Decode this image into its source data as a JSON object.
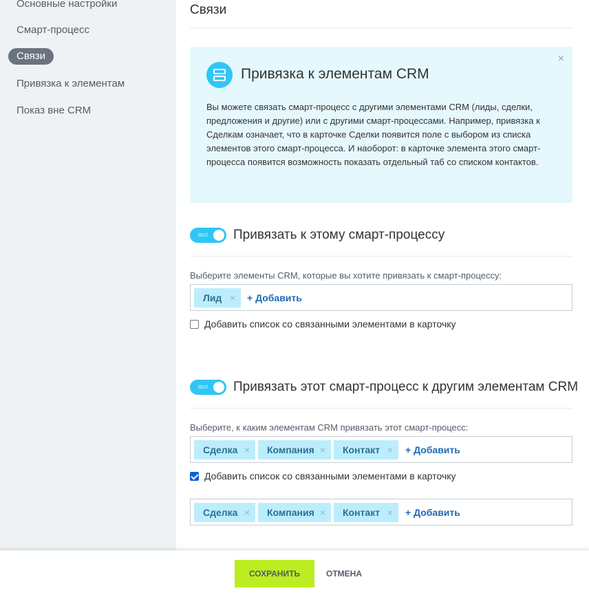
{
  "sidebar": {
    "items": [
      {
        "label": "Основные настройки"
      },
      {
        "label": "Смарт-процесс"
      },
      {
        "label": "Связи",
        "active": true
      },
      {
        "label": "Привязка к элементам"
      },
      {
        "label": "Показ вне CRM"
      }
    ]
  },
  "main": {
    "title": "Связи",
    "info": {
      "title": "Привязка к элементам CRM",
      "text": "Вы можете связать смарт-процесс с другими элементами CRM (лиды, сделки, предложения и другие) или с другими смарт-процессами. Например, привязка к Сделкам означает, что в карточке Сделки появится поле с выбором из списка элементов этого смарт-процесса. И наоборот: в карточке элемента этого смарт-процесса появится возможность показать отдельный таб со списком контактов.",
      "close": "×",
      "icon": "list-icon"
    },
    "section1": {
      "toggle_label": "вкл",
      "toggle_on": true,
      "title": "Привязать к этому смарт-процессу",
      "field_label": "Выберите элементы CRM, которые вы хотите привязать к смарт-процессу:",
      "tags": [
        "Лид"
      ],
      "add_label": "+ Добавить",
      "checkbox_label": "Добавить список со связанными элементами в карточку",
      "checkbox_checked": false
    },
    "section2": {
      "toggle_label": "вкл",
      "toggle_on": true,
      "title": "Привязать этот смарт-процесс к другим элементам CRM",
      "field_label": "Выберите, к каким элементам CRM привязать этот смарт-процесс:",
      "tags": [
        "Сделка",
        "Компания",
        "Контакт"
      ],
      "add_label": "+ Добавить",
      "checkbox_label": "Добавить список со связанными элементами в карточку",
      "checkbox_checked": true,
      "tags2": [
        "Сделка",
        "Компания",
        "Контакт"
      ],
      "add_label2": "+ Добавить"
    }
  },
  "footer": {
    "save_label": "Сохранить",
    "cancel_label": "Отмена"
  },
  "colors": {
    "accent": "#2fc6f6",
    "save": "#bbed21",
    "tag_bg": "#bcedfc",
    "info_bg": "#e5f8fd"
  }
}
